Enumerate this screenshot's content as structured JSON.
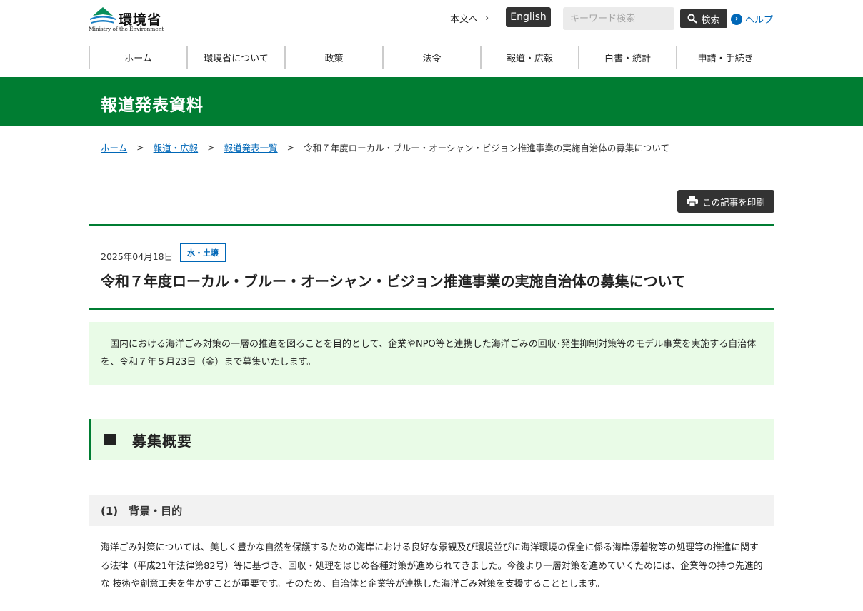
{
  "header": {
    "logo_ja": "環境省",
    "logo_en": "Ministry of the Environment",
    "skip_label": "本文へ",
    "english_label": "English",
    "search_placeholder": "キーワード検索",
    "search_button_label": "検索",
    "help_label": "ヘルプ"
  },
  "nav": {
    "items": [
      "ホーム",
      "環境省について",
      "政策",
      "法令",
      "報道・広報",
      "白書・統計",
      "申請・手続き"
    ]
  },
  "banner": {
    "title": "報道発表資料"
  },
  "breadcrumb": {
    "items": [
      "ホーム",
      "報道・広報",
      "報道発表一覧"
    ],
    "separator": ">",
    "current": "令和７年度ローカル・ブルー・オーシャン・ビジョン推進事業の実施自治体の募集について"
  },
  "print_button_label": "この記事を印刷",
  "article": {
    "date": "2025年04月18日",
    "category": "水・土壌",
    "title": "令和７年度ローカル・ブルー・オーシャン・ビジョン推進事業の実施自治体の募集について",
    "summary": "　国内における海洋ごみ対策の一層の推進を図ることを目的として、企業やNPO等と連携した海洋ごみの回収･発生抑制対策等のモデル事業を実施する自治体を、令和７年５月23日（金）まで募集いたします。"
  },
  "section": {
    "heading": "募集概要",
    "subheading": "(1)　背景・目的",
    "body": "海洋ごみ対策については、美しく豊かな自然を保護するための海岸における良好な景観及び環境並びに海洋環境の保全に係る海岸漂着物等の処理等の推進に関する法律（平成21年法律第82号）等に基づき、回収・処理をはじめ各種対策が進められてきました。今後より一層対策を進めていくためには、企業等の持つ先進的な 技術や創意工夫を生かすことが重要です。そのため、自治体と企業等が連携した海洋ごみ対策を支援することとします。"
  },
  "colors": {
    "brand_green": "#007d32",
    "link_blue": "#0067b7",
    "light_green": "#e9fbe7",
    "dark_button": "#333333"
  }
}
